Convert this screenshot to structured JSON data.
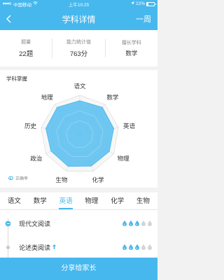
{
  "status_bar": {
    "carrier": "中国移动",
    "time": "上午10:25",
    "battery": "22%",
    "battery_level": 0.22
  },
  "nav": {
    "title": "学科详情",
    "period": "一周"
  },
  "summary": [
    {
      "label": "题量",
      "value": "22题"
    },
    {
      "label": "能力统计值",
      "value": "763分"
    },
    {
      "label": "擅长学科",
      "value": "数学"
    }
  ],
  "mastery": {
    "title": "学科掌握",
    "legend": "正确率",
    "subjects": [
      "语文",
      "数学",
      "英语",
      "物理",
      "化学",
      "生物",
      "政治",
      "历史",
      "地理"
    ],
    "values": [
      0.86,
      0.9,
      0.88,
      0.87,
      0.86,
      0.87,
      0.85,
      0.88,
      0.9
    ],
    "colors": {
      "fill": "#5ec1ef",
      "stroke": "#46b8ee",
      "grid": "#dcdcdc"
    }
  },
  "tabs": [
    "语文",
    "数学",
    "英语",
    "物理",
    "化学",
    "生物"
  ],
  "active_tab": 2,
  "topics": [
    {
      "name": "现代文阅读",
      "level": 3,
      "max": 5,
      "trend": ""
    },
    {
      "name": "论述类阅读",
      "level": 3,
      "max": 5,
      "trend": "up"
    }
  ],
  "share_button": "分享给家长",
  "accent": "#46b8ee"
}
